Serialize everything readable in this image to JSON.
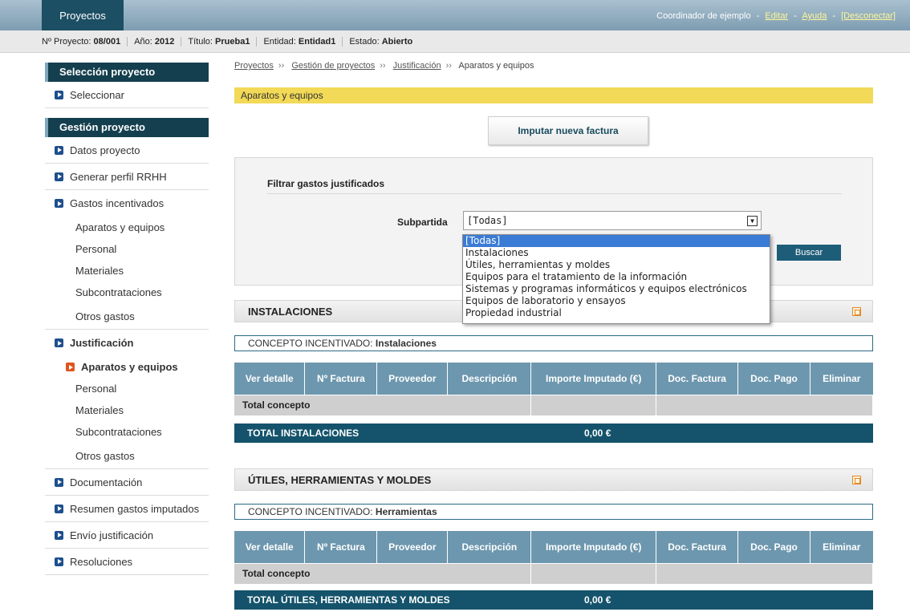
{
  "topbar": {
    "brand": "Proyectos",
    "user": "Coordinador de ejemplo",
    "links": [
      "Editar",
      "Ayuda"
    ],
    "logout": "[Desconectar]",
    "separator": "-"
  },
  "infobar": [
    {
      "label": "Nº Proyecto:",
      "value": "08/001"
    },
    {
      "label": "Año:",
      "value": "2012"
    },
    {
      "label": "Título:",
      "value": "Prueba1"
    },
    {
      "label": "Entidad:",
      "value": "Entidad1"
    },
    {
      "label": "Estado:",
      "value": "Abierto"
    }
  ],
  "sidebar": {
    "section1": "Selección proyecto",
    "seleccionar": "Seleccionar",
    "section2": "Gestión proyecto",
    "datos": "Datos proyecto",
    "perfil": "Generar perfil RRHH",
    "gastos": "Gastos incentivados",
    "gastos_sub": [
      "Aparatos y equipos",
      "Personal",
      "Materiales",
      "Subcontrataciones",
      "Otros gastos"
    ],
    "justificacion": "Justificación",
    "just_sub": [
      "Aparatos y equipos",
      "Personal",
      "Materiales",
      "Subcontrataciones",
      "Otros gastos"
    ],
    "documentacion": "Documentación",
    "resumen": "Resumen gastos imputados",
    "envio": "Envío justificación",
    "resoluciones": "Resoluciones"
  },
  "breadcrumb": {
    "items": [
      "Proyectos",
      "Gestión de proyectos",
      "Justificación"
    ],
    "current": "Aparatos y equipos",
    "sep": "››"
  },
  "page_title": "Aparatos y equipos",
  "new_invoice_button": "Imputar nueva factura",
  "filter": {
    "title": "Filtrar gastos justificados",
    "label": "Subpartida",
    "selected": "[Todas]",
    "button": "Buscar",
    "options": [
      "[Todas]",
      "Instalaciones",
      "Útiles, herramientas y moldes",
      "Equipos para el tratamiento de la información",
      "Sistemas y programas informáticos y equipos electrónicos",
      "Equipos de laboratorio y ensayos",
      "Propiedad industrial"
    ]
  },
  "table_headers": [
    "Ver detalle",
    "Nº Factura",
    "Proveedor",
    "Descripción",
    "Importe Imputado (€)",
    "Doc. Factura",
    "Doc. Pago",
    "Eliminar"
  ],
  "sections": [
    {
      "title": "INSTALACIONES",
      "concepto_label": "CONCEPTO INCENTIVADO:",
      "concepto_value": "Instalaciones",
      "total_concepto": "Total concepto",
      "total_label": "TOTAL INSTALACIONES",
      "total_value": "0,00 €"
    },
    {
      "title": "ÚTILES, HERRAMIENTAS Y MOLDES",
      "concepto_label": "CONCEPTO INCENTIVADO:",
      "concepto_value": "Herramientas",
      "total_concepto": "Total concepto",
      "total_label": "TOTAL ÚTILES, HERRAMIENTAS Y MOLDES",
      "total_value": "0,00 €"
    }
  ]
}
